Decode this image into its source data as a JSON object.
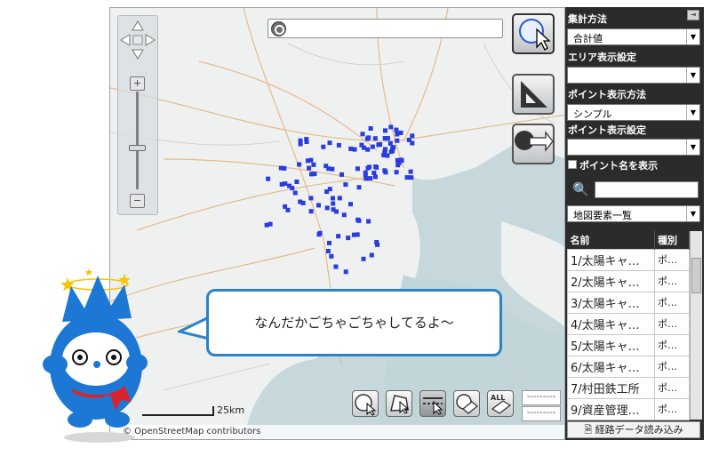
{
  "map": {
    "search_placeholder": "",
    "scale_label": "25km",
    "attribution": "© OpenStreetMap contributors",
    "bottom_fields": [
      "---------",
      "---------"
    ],
    "all_label": "ALL"
  },
  "panel": {
    "aggregation_label": "集計方法",
    "aggregation_value": "合計値",
    "area_label": "エリア表示設定",
    "area_value": "",
    "point_method_label": "ポイント表示方法",
    "point_method_value": "シンプル",
    "point_setting_label": "ポイント表示設定",
    "point_setting_value": "",
    "show_names_label": "ポイント名を表示",
    "filter_value": "",
    "layer_select_value": "地図要素一覧",
    "columns": [
      "名前",
      "種別"
    ],
    "rows": [
      {
        "name": "1/太陽キャ…",
        "kind": "ポ…"
      },
      {
        "name": "2/太陽キャ…",
        "kind": "ポ…"
      },
      {
        "name": "3/太陽キャ…",
        "kind": "ポ…"
      },
      {
        "name": "4/太陽キャ…",
        "kind": "ポ…"
      },
      {
        "name": "5/太陽キャ…",
        "kind": "ポ…"
      },
      {
        "name": "6/太陽キャ…",
        "kind": "ポ…"
      },
      {
        "name": "7/村田鉄工所",
        "kind": "ポ…"
      },
      {
        "name": "9/資産管理…",
        "kind": "ポ…"
      }
    ],
    "load_button": "経路データ読み込み"
  },
  "bubble_text": "なんだかごちゃごちゃしてるよ〜",
  "colors": {
    "accent": "#2b83c6",
    "point": "#2a3be0",
    "panel_bg": "#2b2b2b",
    "water": "#c6d8dc"
  }
}
